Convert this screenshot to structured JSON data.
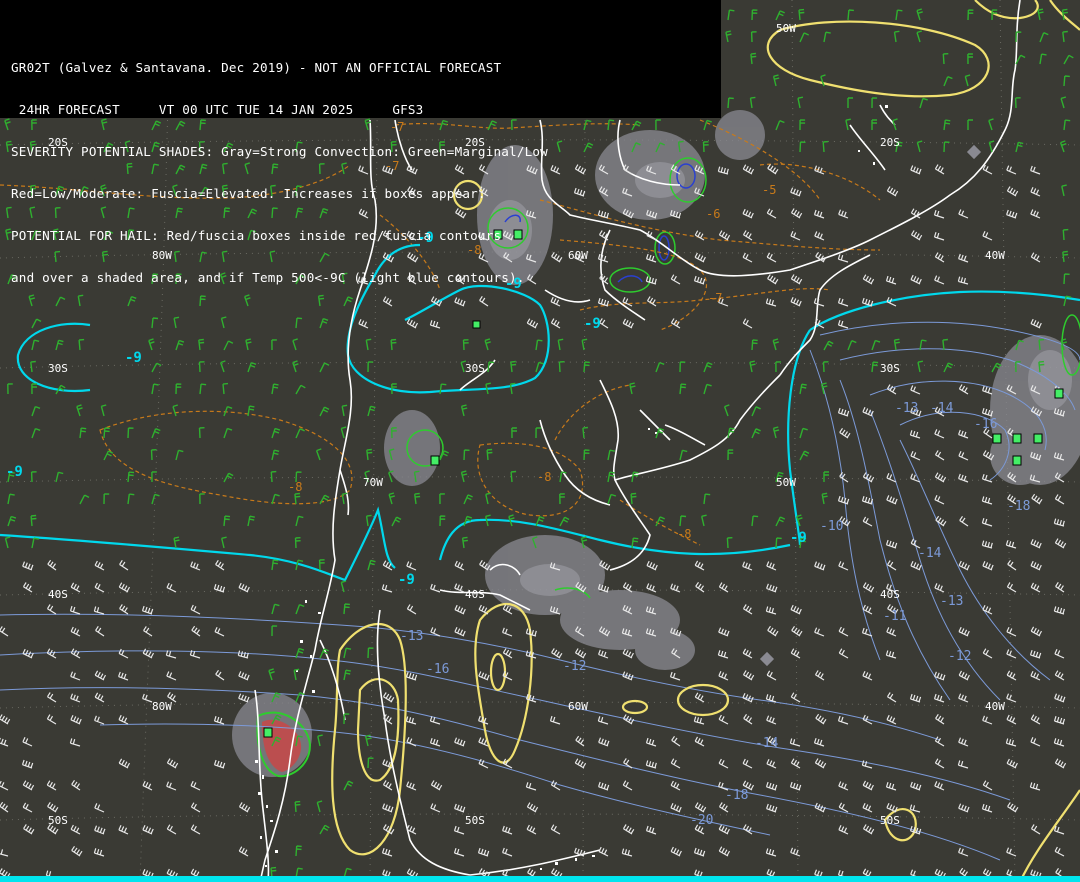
{
  "header": {
    "lines": [
      "GR02T (Galvez & Santavana. Dec 2019) - NOT AN OFFICIAL FORECAST",
      " 24HR FORECAST     VT 00 UTC TUE 14 JAN 2025     GFS3",
      "SEVERITY POTENTIAL SHADES: Gray=Strong Convection: Green=Marginal/Low",
      "Red=Low/Moderate: Fuscia=Elevated. Increases if boxes appear.",
      "POTENTIAL FOR HAIL: Red/fuscia boxes inside red/fuscia contours",
      "and over a shaded area, and if Temp 500<-9C (light blue contours)."
    ]
  },
  "grid_labels": {
    "lat_20": "20S",
    "lat_30": "30S",
    "lat_40": "40S",
    "lat_50": "50S",
    "lon_40": "40W",
    "lon_50": "50W",
    "lon_60": "60W",
    "lon_70": "70W",
    "lon_80": "80W"
  },
  "contour_labels": {
    "temp_cyan": [
      "-9",
      "-9",
      "-9",
      "-9",
      "-9",
      "-9",
      "-9",
      "-9"
    ],
    "temp_blue": [
      "-10",
      "-11",
      "-12",
      "-12",
      "-13",
      "-13",
      "-14",
      "-14",
      "-14",
      "-16",
      "-18",
      "-18",
      "-20",
      "-13",
      "-16"
    ],
    "lapse_orange": [
      "-8",
      "-8",
      "-8",
      "-8",
      "-7",
      "-7",
      "-7",
      "-5",
      "-6",
      "-8"
    ]
  },
  "colors": {
    "background": "#3a3a34",
    "coastline": "#ffffff",
    "temp_minus9": "#00d8ec",
    "temp_cold": "#7c9ad8",
    "lapse_dashed": "#c87a1a",
    "jet_yellow": "#f0e070",
    "convection_gray": "#8a8a90",
    "marginal_green": "#2ecc2e",
    "low_moderate_red": "#d04040",
    "wind_barb_green": "#2fb02f",
    "wind_barb_white": "#e8e8e8",
    "hail_box": "#44ee66"
  }
}
